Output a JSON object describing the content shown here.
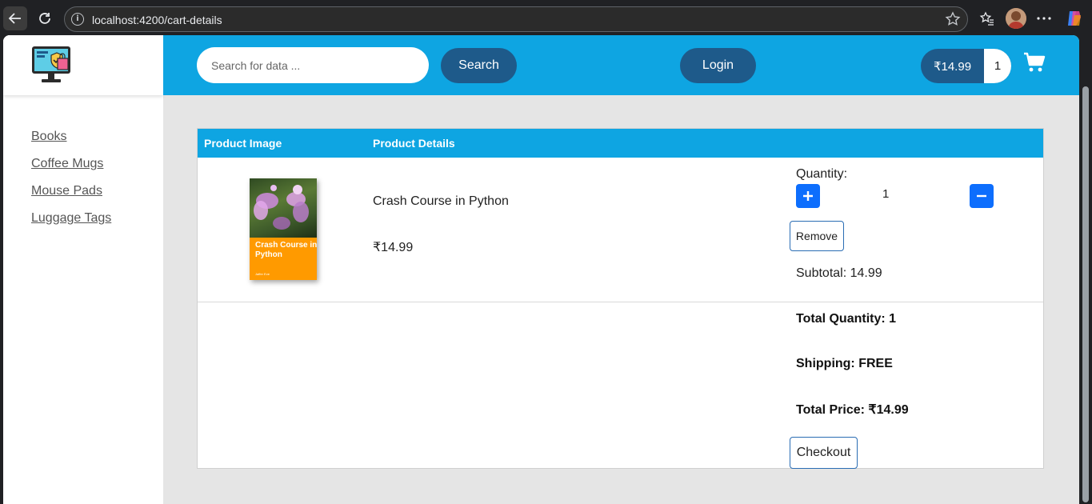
{
  "browser": {
    "url": "localhost:4200/cart-details"
  },
  "sidebar": {
    "items": [
      {
        "label": "Books"
      },
      {
        "label": "Coffee Mugs"
      },
      {
        "label": "Mouse Pads"
      },
      {
        "label": "Luggage Tags"
      }
    ]
  },
  "header": {
    "search_placeholder": "Search for data ...",
    "search_label": "Search",
    "login_label": "Login",
    "cart_total": "₹14.99",
    "cart_count": "1"
  },
  "table": {
    "col_image": "Product Image",
    "col_details": "Product Details",
    "item": {
      "book_cover_title": "Crash Course in Python",
      "book_cover_author": "Jaffer Eve",
      "name": "Crash Course in Python",
      "price": "₹14.99",
      "quantity_label": "Quantity:",
      "quantity": "1",
      "remove_label": "Remove",
      "subtotal": "Subtotal: 14.99"
    },
    "summary": {
      "total_quantity": "Total Quantity: 1",
      "shipping": "Shipping: FREE",
      "total_price": "Total Price: ₹14.99",
      "checkout_label": "Checkout"
    }
  },
  "colors": {
    "header_bg": "#0ea5e2",
    "pill_bg": "#1e5a8a",
    "qty_button": "#0d6efd"
  }
}
